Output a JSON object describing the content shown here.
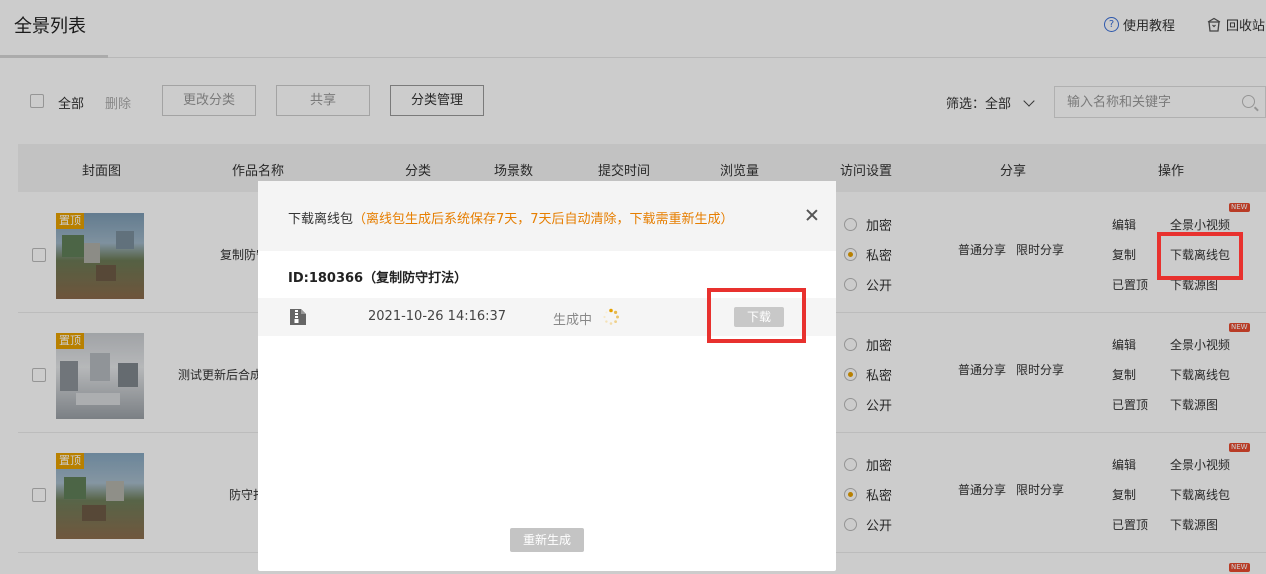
{
  "header": {
    "title": "全景列表",
    "help_label": "使用教程",
    "trash_label": "回收站"
  },
  "toolbar": {
    "select_all": "全部",
    "delete": "删除",
    "change_category": "更改分类",
    "share": "共享",
    "category_manage": "分类管理",
    "filter_label": "筛选：全部",
    "search_placeholder": "输入名称和关键字"
  },
  "table": {
    "columns": [
      "封面图",
      "作品名称",
      "分类",
      "场景数",
      "提交时间",
      "浏览量",
      "访问设置",
      "分享",
      "操作"
    ],
    "pin_label": "置顶",
    "access_options": [
      "加密",
      "私密",
      "公开"
    ],
    "share_options": [
      "普通分享",
      "限时分享"
    ],
    "new_badge": "NEW",
    "rows": [
      {
        "name": "复制防守",
        "ops_left": [
          "编辑",
          "复制",
          "已置顶"
        ],
        "ops_right": [
          "全景小视频",
          "下载离线包",
          "下载源图"
        ]
      },
      {
        "name": "测试更新后合成",
        "ops_left": [
          "编辑",
          "复制",
          "已置顶"
        ],
        "ops_right": [
          "全景小视频",
          "下载离线包",
          "下载源图"
        ]
      },
      {
        "name": "防守打",
        "ops_left": [
          "编辑",
          "复制",
          "已置顶"
        ],
        "ops_right": [
          "全景小视频",
          "下载离线包",
          "下载源图"
        ]
      }
    ]
  },
  "modal": {
    "title": "下载离线包",
    "note": "（离线包生成后系统保存7天，7天后自动清除，下载需重新生成）",
    "id_label": "ID:180366（复制防守打法）",
    "package": {
      "time": "2021-10-26 14:16:37",
      "status": "生成中",
      "download": "下载"
    },
    "regenerate": "重新生成"
  },
  "colors": {
    "accent": "#e6a100",
    "highlight": "#e8312e",
    "note": "#e67e00"
  }
}
